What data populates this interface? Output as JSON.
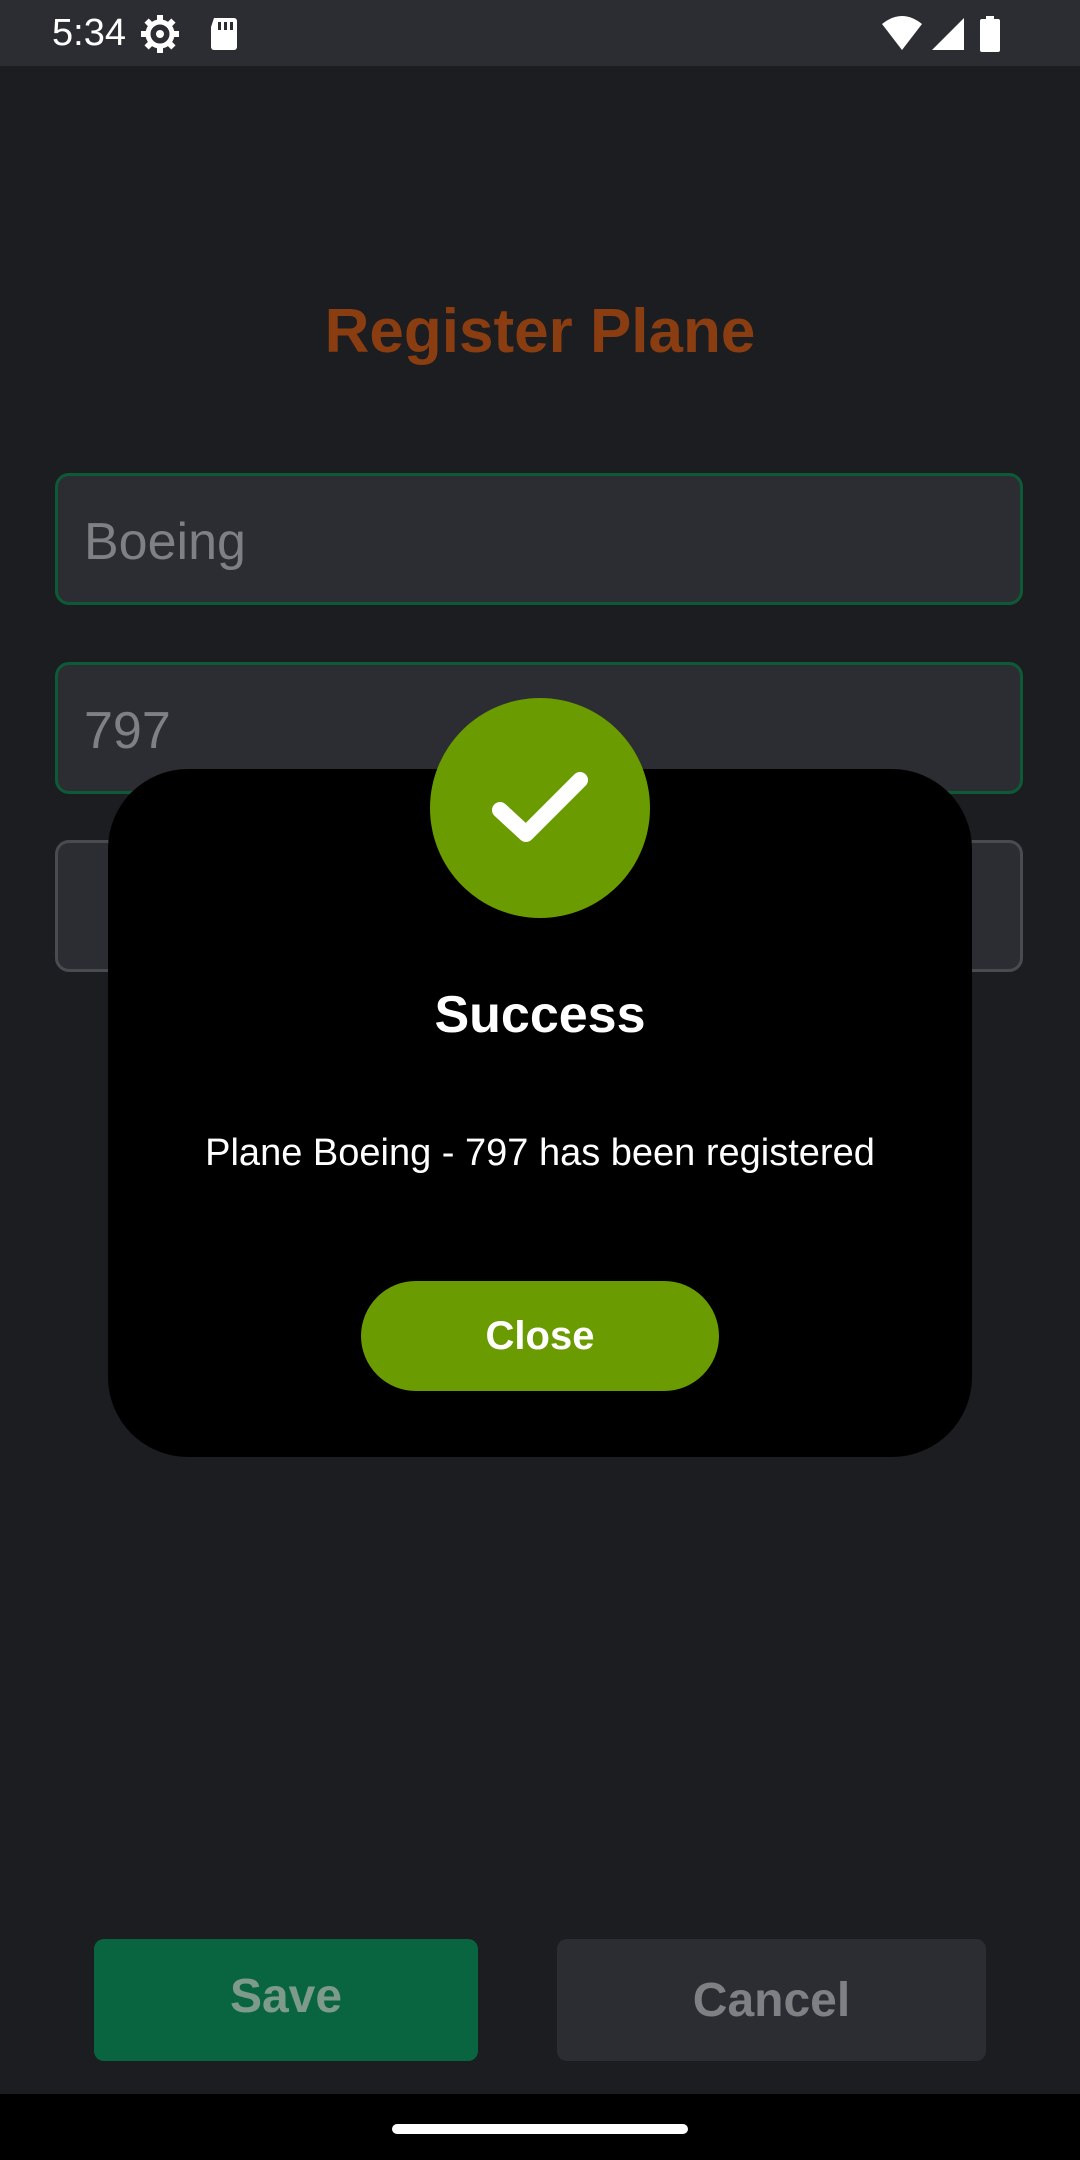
{
  "status_bar": {
    "time": "5:34",
    "icons": [
      "settings-gear-icon",
      "sd-card-icon",
      "wifi-icon",
      "cell-signal-icon",
      "battery-icon"
    ]
  },
  "page": {
    "title": "Register Plane",
    "fields": [
      {
        "value": "Boeing"
      },
      {
        "value": "797"
      },
      {
        "value": ""
      }
    ],
    "save_label": "Save",
    "cancel_label": "Cancel"
  },
  "dialog": {
    "icon": "checkmark-icon",
    "title": "Success",
    "message": "Plane Boeing - 797 has been registered",
    "close_label": "Close"
  },
  "colors": {
    "background": "#1c1d21",
    "title": "#8a3d10",
    "success_green": "#6a9b00",
    "save_green": "#096540",
    "field_border_active": "#0d5b36"
  }
}
